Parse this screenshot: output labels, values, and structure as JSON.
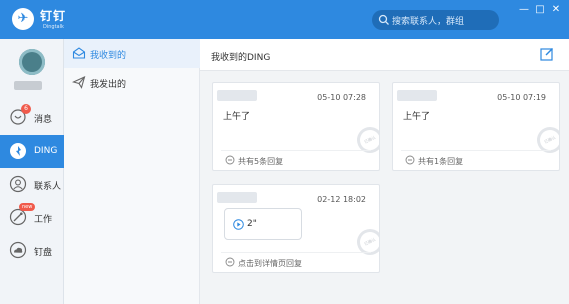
{
  "titlebar": {
    "logo_glyph": "✈",
    "brand": "钉钉",
    "brand_sub": "Dingtalk",
    "search_placeholder": "搜索联系人，群组",
    "minimize": "—",
    "maximize": "□",
    "close": "✕"
  },
  "leftnav": {
    "items": [
      {
        "label": "消息",
        "icon": "chat-bubble-icon",
        "badge": "6"
      },
      {
        "label": "DING",
        "icon": "ding-icon",
        "active": true
      },
      {
        "label": "联系人",
        "icon": "contacts-icon"
      },
      {
        "label": "工作",
        "icon": "work-icon",
        "badge": "new"
      },
      {
        "label": "钉盘",
        "icon": "cloud-drive-icon"
      }
    ]
  },
  "subnav": {
    "items": [
      {
        "label": "我收到的",
        "icon": "inbox-icon",
        "active": true
      },
      {
        "label": "我发出的",
        "icon": "send-icon"
      }
    ]
  },
  "main": {
    "title": "我收到的DING",
    "cards": [
      {
        "time": "05-10 07:28",
        "message": "上午了",
        "footer": "共有5条回复",
        "stamp": "已确认"
      },
      {
        "time": "05-10 07:19",
        "message": "上午了",
        "footer": "共有1条回复",
        "stamp": "已确认"
      },
      {
        "time": "02-12 18:02",
        "voice_length": "2\"",
        "footer": "点击到详情页回复",
        "stamp": "已确认"
      }
    ]
  },
  "colors": {
    "accent": "#2e89e0",
    "badge": "#f05a4b"
  }
}
